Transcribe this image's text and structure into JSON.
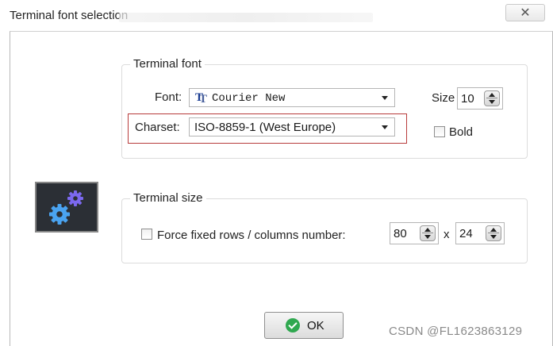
{
  "window": {
    "title": "Terminal font selection",
    "close_symbol": "✕"
  },
  "terminal_font": {
    "legend": "Terminal font",
    "font_label": "Font:",
    "font_value": "Courier New",
    "font_icon": "truetype-icon",
    "charset_label": "Charset:",
    "charset_value": "ISO-8859-1 (West Europe)",
    "size_label": "Size",
    "size_value": "10",
    "bold_label": "Bold",
    "bold_checked": false
  },
  "terminal_size": {
    "legend": "Terminal size",
    "force_label": "Force fixed rows / columns number:",
    "force_checked": false,
    "rows_value": "80",
    "times_symbol": "x",
    "cols_value": "24"
  },
  "ok_button": {
    "label": "OK",
    "icon": "check-circle-icon"
  },
  "watermark": "CSDN @FL1623863129",
  "colors": {
    "highlight_border": "#b83b3b",
    "ok_icon": "#2fa84f",
    "gear_bg": "#2b2f35",
    "gear_blue": "#4aa3f0",
    "gear_purple": "#7b68ee"
  }
}
